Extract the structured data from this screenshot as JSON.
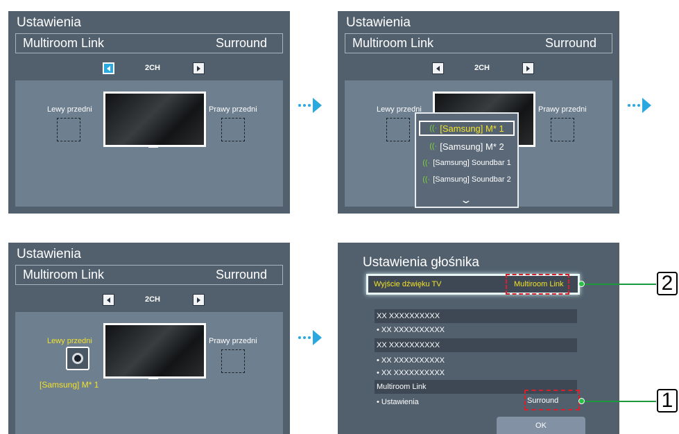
{
  "panels": {
    "p1": {
      "title": "Ustawienia",
      "tab_left": "Multiroom Link",
      "tab_right": "Surround",
      "channel": "2CH",
      "left_label": "Lewy przedni",
      "right_label": "Prawy przedni"
    },
    "p2": {
      "title": "Ustawienia",
      "tab_left": "Multiroom Link",
      "tab_right": "Surround",
      "channel": "2CH",
      "left_label": "Lewy przedni",
      "right_label": "Prawy przedni",
      "dropdown": [
        "[Samsung] M* 1",
        "[Samsung] M* 2",
        "[Samsung] Soundbar 1",
        "[Samsung] Soundbar 2"
      ]
    },
    "p3": {
      "title": "Ustawienia",
      "tab_left": "Multiroom Link",
      "tab_right": "Surround",
      "channel": "2CH",
      "left_label": "Lewy przedni",
      "right_label": "Prawy przedni",
      "assigned": "[Samsung] M* 1"
    },
    "p4": {
      "title": "Ustawienia głośnika",
      "tv_output_label": "Wyjście dźwięku TV",
      "tv_output_value": "Multiroom Link",
      "rows": [
        "XX XXXXXXXXXX",
        "• XX XXXXXXXXXX",
        "XX XXXXXXXXXX",
        "• XX XXXXXXXXXX",
        "• XX XXXXXXXXXX",
        "Multiroom Link",
        "• Ustawienia"
      ],
      "setting_value": "Surround",
      "ok": "OK"
    }
  },
  "callouts": [
    "2",
    "1"
  ],
  "colors": {
    "accent": "#2aa8e0",
    "highlight_text": "#f2e22a",
    "callout_green": "#1a9a3a",
    "dashed_red": "#d9202a"
  }
}
